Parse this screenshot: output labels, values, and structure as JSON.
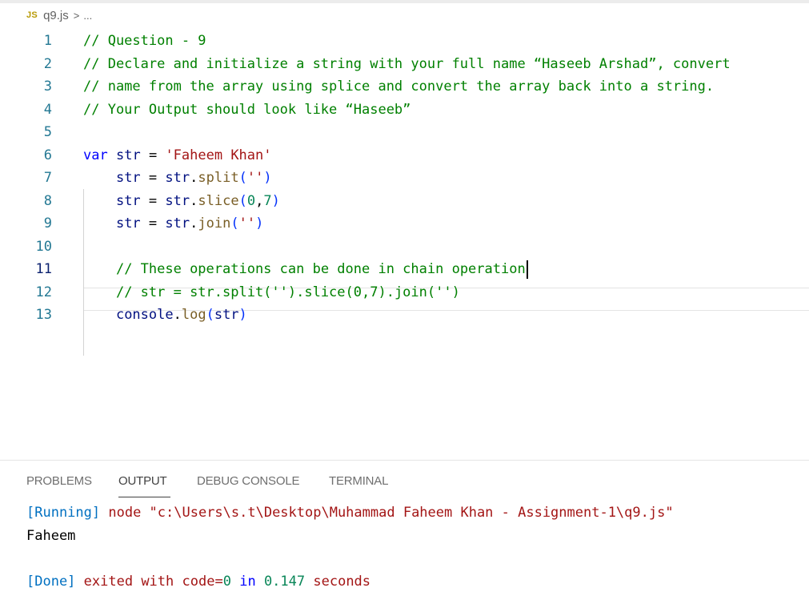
{
  "breadcrumb": {
    "lang_badge": "JS",
    "file": "q9.js",
    "separator": ">",
    "more": "..."
  },
  "editor": {
    "lines": [
      {
        "n": "1",
        "text": "// Question - 9"
      },
      {
        "n": "2",
        "text": "// Declare and initialize a string with your full name “Haseeb Arshad”, convert"
      },
      {
        "n": "3",
        "text": "// name from the array using splice and convert the array back into a string."
      },
      {
        "n": "4",
        "text": "// Your Output should look like “Haseeb”"
      },
      {
        "n": "5",
        "text": ""
      },
      {
        "n": "6",
        "text": "var str = 'Faheem Khan'"
      },
      {
        "n": "7",
        "text": "    str = str.split('')"
      },
      {
        "n": "8",
        "text": "    str = str.slice(0,7)"
      },
      {
        "n": "9",
        "text": "    str = str.join('')"
      },
      {
        "n": "10",
        "text": ""
      },
      {
        "n": "11",
        "text": "    // These operations can be done in chain operation"
      },
      {
        "n": "12",
        "text": "    // str = str.split('').slice(0,7).join('')"
      },
      {
        "n": "13",
        "text": "    console.log(str)"
      }
    ],
    "current_line": "11"
  },
  "panel": {
    "tabs": [
      "PROBLEMS",
      "OUTPUT",
      "DEBUG CONSOLE",
      "TERMINAL"
    ],
    "active_tab": "OUTPUT"
  },
  "output": {
    "running_label": "[Running]",
    "running_cmd": "node \"c:\\Users\\s.t\\Desktop\\Muhammad Faheem Khan - Assignment-1\\q9.js\"",
    "result": "Faheem",
    "done_label": "[Done]",
    "done_text_1": "exited with",
    "done_code_kw": "code=",
    "done_code_val": "0",
    "done_in": "in",
    "done_time": "0.147",
    "done_seconds": "seconds"
  },
  "colors": {
    "comment": "#008000",
    "keyword": "#0000ff",
    "variable": "#001080",
    "string": "#a31515",
    "number": "#098658",
    "function": "#795e26",
    "line_number": "#237893",
    "js_badge": "#b79a05"
  }
}
